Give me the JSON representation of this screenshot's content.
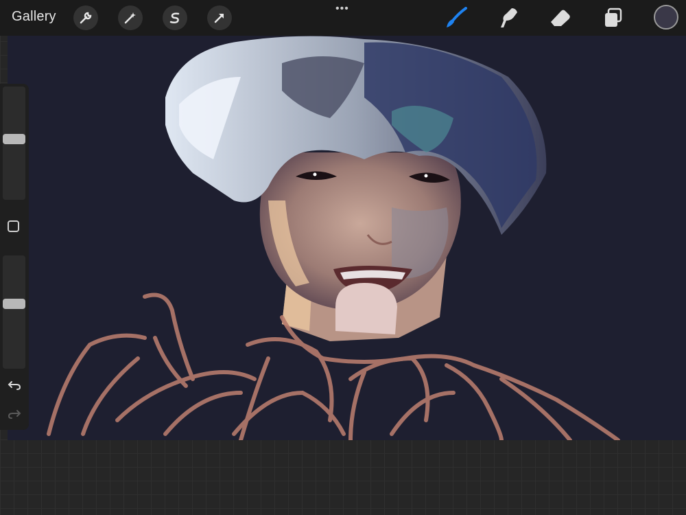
{
  "topbar": {
    "gallery_label": "Gallery",
    "left_tools": [
      "wrench-icon",
      "magic-wand-icon",
      "selection-s-icon",
      "transform-arrow-icon"
    ],
    "more_label": "•••",
    "right_tools": [
      "brush-icon",
      "smudge-icon",
      "eraser-icon",
      "layers-icon"
    ],
    "active_tool": "brush-icon",
    "current_color": "#3a3848",
    "accent_color": "#1e82f0"
  },
  "sidebar": {
    "brush_size_level": 0.55,
    "opacity_level": 0.55
  },
  "canvas": {
    "background": "#1e1f30"
  }
}
